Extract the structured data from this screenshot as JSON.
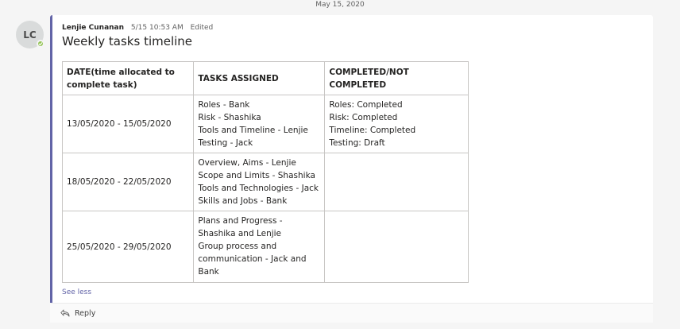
{
  "date_divider": "May 15, 2020",
  "avatar": {
    "initials": "LC",
    "presence": "available"
  },
  "message": {
    "author": "Lenjie Cunanan",
    "time": "5/15 10:53 AM",
    "edited": "Edited",
    "title": "Weekly tasks timeline",
    "table": {
      "headers": [
        "DATE(time allocated to complete task)",
        "TASKS ASSIGNED",
        "COMPLETED/NOT COMPLETED"
      ],
      "rows": [
        {
          "range": "13/05/2020 - 15/05/2020",
          "tasks": [
            "Roles - Bank",
            "Risk - Shashika",
            "Tools and Timeline - Lenjie",
            "Testing - Jack"
          ],
          "status": [
            "Roles: Completed",
            "Risk: Completed",
            "Timeline: Completed",
            "Testing: Draft"
          ]
        },
        {
          "range": "18/05/2020 - 22/05/2020",
          "tasks": [
            "Overview, Aims - Lenjie",
            "Scope and Limits - Shashika",
            "Tools and Technologies - Jack",
            "Skills and Jobs - Bank"
          ],
          "status": []
        },
        {
          "range": "25/05/2020 - 29/05/2020",
          "tasks": [
            "Plans and Progress - Shashika and Lenjie",
            "Group process and communication - Jack and Bank"
          ],
          "status": []
        }
      ]
    },
    "see_less": "See less"
  },
  "reply": {
    "label": "Reply",
    "icon": "reply-icon"
  },
  "colors": {
    "accent": "#6264a7",
    "presence": "#92c353"
  }
}
